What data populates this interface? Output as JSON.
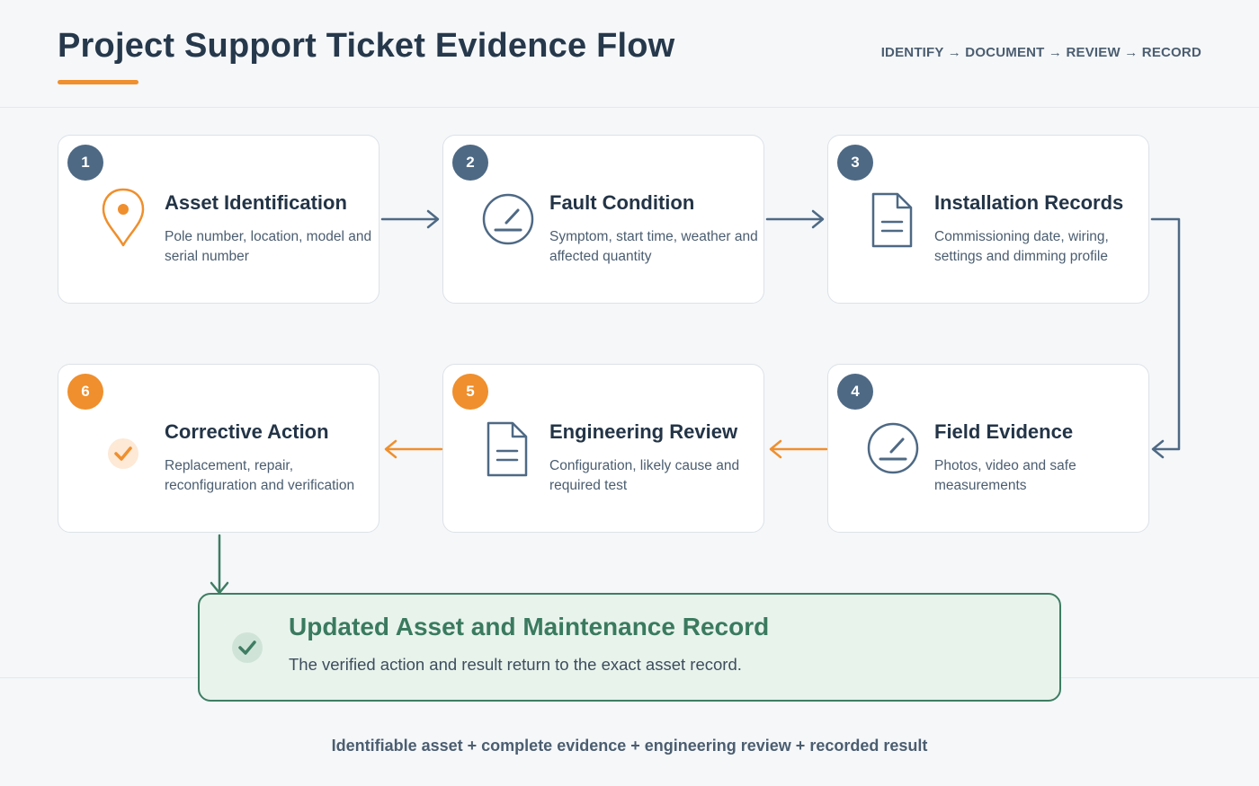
{
  "header": {
    "title": "Project Support Ticket Evidence Flow",
    "tagline": "IDENTIFY → DOCUMENT → REVIEW → RECORD"
  },
  "steps": [
    {
      "number": "1",
      "title": "Asset Identification",
      "desc": "Pole number, location, model and serial number",
      "icon": "location-pin-icon",
      "badge_color": "#4e6984"
    },
    {
      "number": "2",
      "title": "Fault Condition",
      "desc": "Symptom, start time, weather and affected quantity",
      "icon": "gauge-icon",
      "badge_color": "#4e6984"
    },
    {
      "number": "3",
      "title": "Installation Records",
      "desc": "Commissioning date, wiring, settings and dimming profile",
      "icon": "document-icon",
      "badge_color": "#4e6984"
    },
    {
      "number": "4",
      "title": "Field Evidence",
      "desc": "Photos, video and safe measurements",
      "icon": "gauge-icon",
      "badge_color": "#4e6984"
    },
    {
      "number": "5",
      "title": "Engineering Review",
      "desc": "Configuration, likely cause and required test",
      "icon": "document-icon",
      "badge_color": "#ef8f2d"
    },
    {
      "number": "6",
      "title": "Corrective Action",
      "desc": "Replacement, repair, reconfiguration and verification",
      "icon": "check-icon",
      "badge_color": "#ef8f2d"
    }
  ],
  "result": {
    "title": "Updated Asset and Maintenance Record",
    "desc": "The verified action and result return to the exact asset record.",
    "icon": "check-circle-icon"
  },
  "footer": {
    "text": "Identifiable asset + complete evidence + engineering review + recorded result"
  },
  "colors": {
    "accent_orange": "#ef8f2d",
    "step_blue": "#4e6984",
    "result_green": "#3e7d63",
    "result_bg": "#e8f3ec"
  }
}
